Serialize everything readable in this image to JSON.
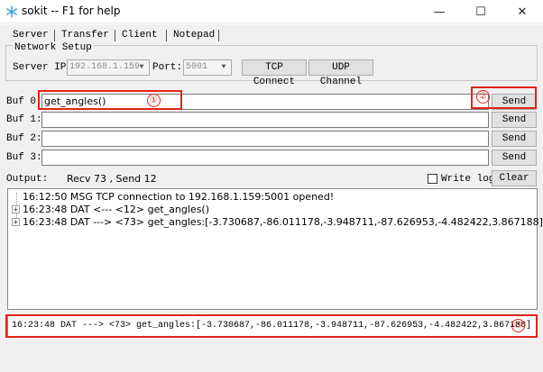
{
  "window": {
    "title": "sokit -- F1 for help",
    "minimize_glyph": "—",
    "maximize_glyph": "☐",
    "close_glyph": "✕"
  },
  "tabs": [
    {
      "label": "Server"
    },
    {
      "label": "Transfer"
    },
    {
      "label": "Client"
    },
    {
      "label": "Notepad"
    }
  ],
  "network_setup": {
    "legend": "Network Setup",
    "server_ip_label": "Server IP:",
    "server_ip_value": "192.168.1.159",
    "port_label": "Port:",
    "port_value": "5001",
    "tcp_connect_label": "TCP Connect",
    "udp_channel_label": "UDP Channel"
  },
  "buffers": [
    {
      "label": "Buf 0:",
      "value": "get_angles()",
      "send_label": "Send"
    },
    {
      "label": "Buf 1:",
      "value": "",
      "send_label": "Send"
    },
    {
      "label": "Buf 2:",
      "value": "",
      "send_label": "Send"
    },
    {
      "label": "Buf 3:",
      "value": "",
      "send_label": "Send"
    }
  ],
  "output": {
    "label": "Output:",
    "counters": "Recv 73 , Send 12",
    "write_log_label": "Write log",
    "clear_label": "Clear",
    "lines": [
      {
        "expander": "",
        "text": "16:12:50 MSG TCP connection to 192.168.1.159:5001 opened!"
      },
      {
        "expander": "+",
        "text": "16:23:48 DAT <--- <12> get_angles()"
      },
      {
        "expander": "+",
        "text": "16:23:48 DAT ---> <73> get_angles:[-3.730687,-86.011178,-3.948711,-87.626953,-4.482422,3.867188]"
      }
    ]
  },
  "status_line": "16:23:48 DAT ---> <73> get_angles:[-3.730687,-86.011178,-3.948711,-87.626953,-4.482422,3.867188]",
  "annotations": {
    "badge_1": "①",
    "badge_2": "②",
    "badge_3": "③",
    "highlight_color": "#e2231a"
  },
  "icons": {
    "app": "snowflake-icon",
    "expander": "plus-box-icon",
    "combo": "chevron-down-icon"
  }
}
